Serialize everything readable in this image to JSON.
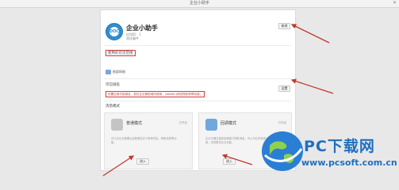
{
  "window": {
    "title": "企业小助手",
    "close_glyph": "✕"
  },
  "app": {
    "logo_text": "DOC",
    "name": "企业小助手",
    "meta_line1": "应用ID：1",
    "meta_line2": "测试事件",
    "edit_label": "修改"
  },
  "visibility": {
    "label": "使用的可见范围",
    "department": "根部网络"
  },
  "callback": {
    "label": "可信域名",
    "warning": "设置应用可信域名，若在企业微信域内使用，(WeiXin)网页授权获得功能。",
    "set_label": "设置"
  },
  "mode": {
    "label": "消息模式",
    "cards": [
      {
        "name": "普通模式",
        "tag": "已开启",
        "desc": "可以在企业管理后台配置自定义菜单内容，获取消息等功能。",
        "button": "进入",
        "icon_color": "#b9b9b9"
      },
      {
        "name": "回调模式",
        "tag": "已开启",
        "desc": "企业可通过接收回调接口获取消息，可以与业务系统对接，实现更多企业功能。",
        "button": "进入",
        "icon_color": "#6fa8dc"
      }
    ]
  },
  "watermark": {
    "title": "PC下载网",
    "url": "www.pcsoft.com.cn"
  },
  "colors": {
    "accent": "#2d8fd0",
    "highlight_red": "#d13b3b",
    "watermark_blue": "#1f6fc0"
  }
}
